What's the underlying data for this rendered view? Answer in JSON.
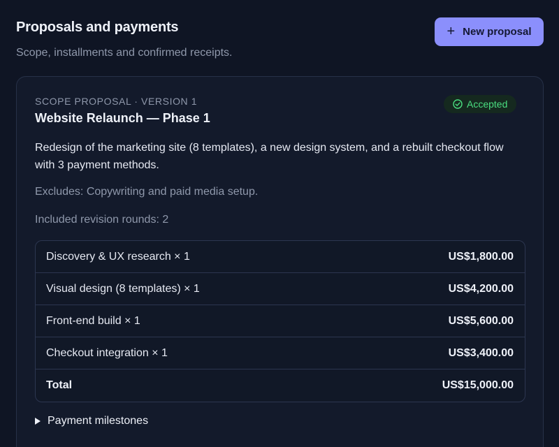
{
  "header": {
    "title": "Proposals and payments",
    "subtitle": "Scope, installments and confirmed receipts.",
    "new_button_label": "New proposal",
    "new_button_icon": "plus-icon"
  },
  "proposal": {
    "eyebrow": "SCOPE PROPOSAL · VERSION 1",
    "title": "Website Relaunch — Phase 1",
    "status": "Accepted",
    "status_icon": "check-circle-icon",
    "status_color": "#4ade80",
    "description": "Redesign of the marketing site (8 templates), a new design system, and a rebuilt checkout flow with 3 payment methods.",
    "excludes": "Excludes: Copywriting and paid media setup.",
    "revision_rounds": "Included revision rounds: 2",
    "line_items": [
      {
        "label": "Discovery & UX research × 1",
        "amount": "US$1,800.00"
      },
      {
        "label": "Visual design (8 templates) × 1",
        "amount": "US$4,200.00"
      },
      {
        "label": "Front-end build × 1",
        "amount": "US$5,600.00"
      },
      {
        "label": "Checkout integration × 1",
        "amount": "US$3,400.00"
      }
    ],
    "total": {
      "label": "Total",
      "amount": "US$15,000.00"
    },
    "milestones_label": "Payment milestones"
  },
  "colors": {
    "accent": "#8b8ffc",
    "background": "#0f1524",
    "card": "#131a2b"
  }
}
